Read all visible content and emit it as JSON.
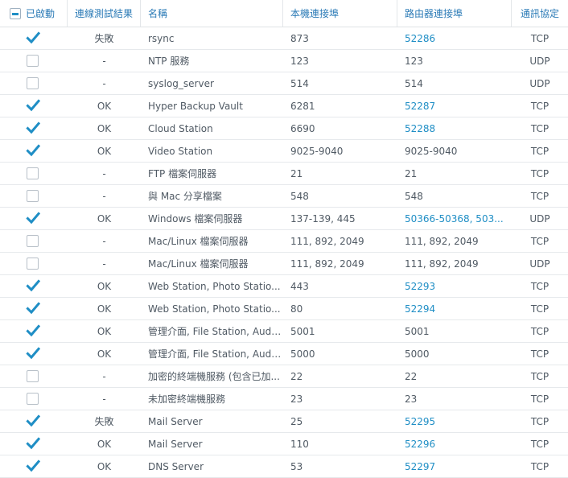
{
  "header": {
    "enabled": "已啟動",
    "test_result": "連線測試結果",
    "name": "名稱",
    "local_port": "本機連接埠",
    "router_port": "路由器連接埠",
    "protocol": "通訊協定"
  },
  "rows": [
    {
      "enabled": true,
      "result": "失敗",
      "name": "rsync",
      "local_port": "873",
      "router_port": "52286",
      "router_link": true,
      "protocol": "TCP"
    },
    {
      "enabled": false,
      "result": "-",
      "name": "NTP 服務",
      "local_port": "123",
      "router_port": "123",
      "router_link": false,
      "protocol": "UDP"
    },
    {
      "enabled": false,
      "result": "-",
      "name": "syslog_server",
      "local_port": "514",
      "router_port": "514",
      "router_link": false,
      "protocol": "UDP"
    },
    {
      "enabled": true,
      "result": "OK",
      "name": "Hyper Backup Vault",
      "local_port": "6281",
      "router_port": "52287",
      "router_link": true,
      "protocol": "TCP"
    },
    {
      "enabled": true,
      "result": "OK",
      "name": "Cloud Station",
      "local_port": "6690",
      "router_port": "52288",
      "router_link": true,
      "protocol": "TCP"
    },
    {
      "enabled": true,
      "result": "OK",
      "name": "Video Station",
      "local_port": "9025-9040",
      "router_port": "9025-9040",
      "router_link": false,
      "protocol": "TCP"
    },
    {
      "enabled": false,
      "result": "-",
      "name": "FTP 檔案伺服器",
      "local_port": "21",
      "router_port": "21",
      "router_link": false,
      "protocol": "TCP"
    },
    {
      "enabled": false,
      "result": "-",
      "name": "與 Mac 分享檔案",
      "local_port": "548",
      "router_port": "548",
      "router_link": false,
      "protocol": "TCP"
    },
    {
      "enabled": true,
      "result": "OK",
      "name": "Windows 檔案伺服器",
      "local_port": "137-139, 445",
      "router_port": "50366-50368, 503...",
      "router_link": true,
      "protocol": "UDP"
    },
    {
      "enabled": false,
      "result": "-",
      "name": "Mac/Linux 檔案伺服器",
      "local_port": "111, 892, 2049",
      "router_port": "111, 892, 2049",
      "router_link": false,
      "protocol": "TCP"
    },
    {
      "enabled": false,
      "result": "-",
      "name": "Mac/Linux 檔案伺服器",
      "local_port": "111, 892, 2049",
      "router_port": "111, 892, 2049",
      "router_link": false,
      "protocol": "UDP"
    },
    {
      "enabled": true,
      "result": "OK",
      "name": "Web Station, Photo Statio...",
      "local_port": "443",
      "router_port": "52293",
      "router_link": true,
      "protocol": "TCP"
    },
    {
      "enabled": true,
      "result": "OK",
      "name": "Web Station, Photo Statio...",
      "local_port": "80",
      "router_port": "52294",
      "router_link": true,
      "protocol": "TCP"
    },
    {
      "enabled": true,
      "result": "OK",
      "name": "管理介面, File Station, Audi...",
      "local_port": "5001",
      "router_port": "5001",
      "router_link": false,
      "protocol": "TCP"
    },
    {
      "enabled": true,
      "result": "OK",
      "name": "管理介面, File Station, Audi...",
      "local_port": "5000",
      "router_port": "5000",
      "router_link": false,
      "protocol": "TCP"
    },
    {
      "enabled": false,
      "result": "-",
      "name": "加密的終端機服務 (包含已加...",
      "local_port": "22",
      "router_port": "22",
      "router_link": false,
      "protocol": "TCP"
    },
    {
      "enabled": false,
      "result": "-",
      "name": "未加密終端機服務",
      "local_port": "23",
      "router_port": "23",
      "router_link": false,
      "protocol": "TCP"
    },
    {
      "enabled": true,
      "result": "失敗",
      "name": "Mail Server",
      "local_port": "25",
      "router_port": "52295",
      "router_link": true,
      "protocol": "TCP"
    },
    {
      "enabled": true,
      "result": "OK",
      "name": "Mail Server",
      "local_port": "110",
      "router_port": "52296",
      "router_link": true,
      "protocol": "TCP"
    },
    {
      "enabled": true,
      "result": "OK",
      "name": "DNS Server",
      "local_port": "53",
      "router_port": "52297",
      "router_link": true,
      "protocol": "TCP"
    }
  ],
  "colors": {
    "accent": "#1f8ec5",
    "text": "#505a64",
    "header_text": "#2a7ab6",
    "border": "#e6e9ec"
  }
}
